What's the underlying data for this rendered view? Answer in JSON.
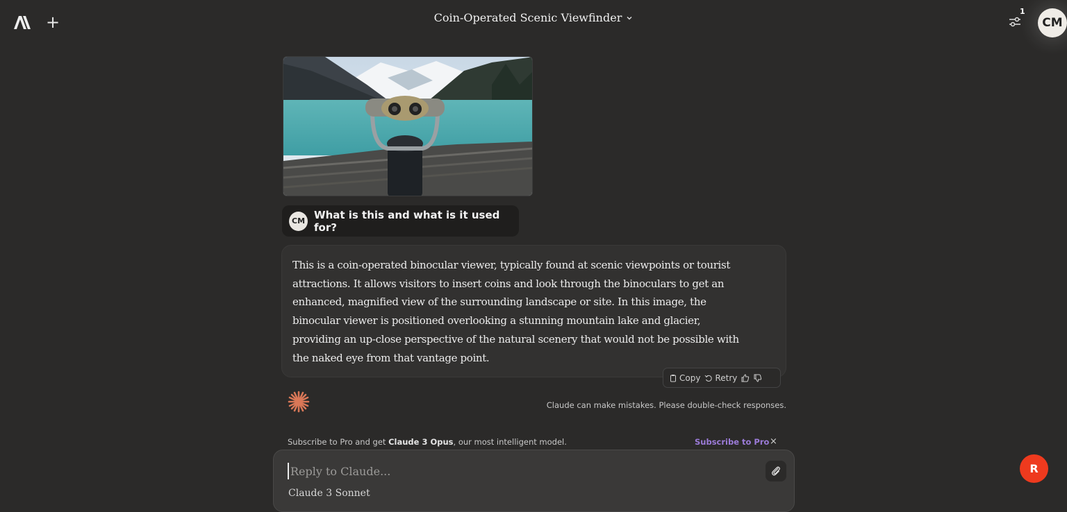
{
  "header": {
    "logo_icon": "anthropic-logo-icon",
    "new_chat_label": "+",
    "conversation_title": "Coin-Operated Scenic Viewfinder",
    "settings_icon": "sliders-icon",
    "settings_badge": "1",
    "user_initials": "CM"
  },
  "conversation": {
    "user_message": {
      "initials": "CM",
      "text": "What is this and what is it used for?"
    },
    "assistant_message": {
      "text": "This is a coin-operated binocular viewer, typically found at scenic viewpoints or tourist attractions. It allows visitors to insert coins and look through the binoculars to get an enhanced, magnified view of the surrounding landscape or site. In this image, the binocular viewer is positioned overlooking a stunning mountain lake and glacier, providing an up-close perspective of the natural scenery that would not be possible with the naked eye from that vantage point."
    },
    "actions": {
      "copy_label": "Copy",
      "retry_label": "Retry"
    },
    "disclaimer": "Claude can make mistakes. Please double-check responses."
  },
  "promo": {
    "prefix": "Subscribe to Pro and get ",
    "highlight": "Claude 3 Opus",
    "suffix": ", our most intelligent model.",
    "link_label": "Subscribe to Pro",
    "close_label": "×"
  },
  "composer": {
    "placeholder": "Reply to Claude...",
    "value": "",
    "model_label": "Claude 3 Sonnet"
  },
  "floating_button": {
    "label": "R"
  },
  "colors": {
    "background": "#2b2a29",
    "accent_link": "#9b7bd8",
    "claude_mark": "#d97757",
    "float_button": "#ee3a1e"
  }
}
